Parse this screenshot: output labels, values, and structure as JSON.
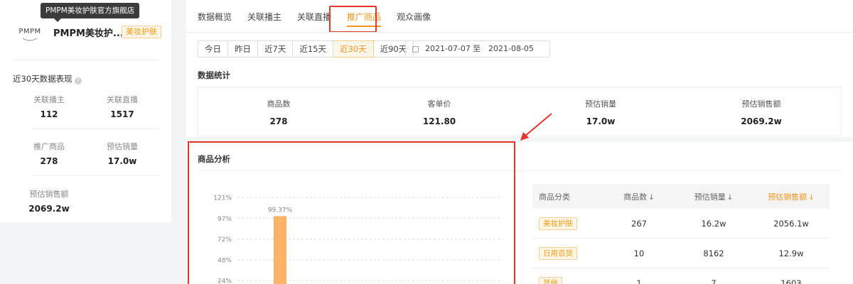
{
  "shop": {
    "logo_text": "PMPM",
    "name": "PMPM美妆护...",
    "tag": "美妆护肤",
    "tooltip": "PMPM美妆护肤官方旗舰店"
  },
  "summary": {
    "title": "近30天数据表现",
    "info_icon": "?",
    "stats": [
      {
        "label": "关联播主",
        "value": "112"
      },
      {
        "label": "关联直播",
        "value": "1517"
      },
      {
        "label": "推广商品",
        "value": "278"
      },
      {
        "label": "预估销量",
        "value": "17.0w"
      },
      {
        "label": "预估销售额",
        "value": "2069.2w"
      }
    ]
  },
  "tabs": [
    {
      "label": "数据概览"
    },
    {
      "label": "关联播主"
    },
    {
      "label": "关联直播"
    },
    {
      "label": "推广商品",
      "active": true
    },
    {
      "label": "观众画像"
    }
  ],
  "ranges": [
    {
      "label": "今日"
    },
    {
      "label": "昨日"
    },
    {
      "label": "近7天"
    },
    {
      "label": "近15天"
    },
    {
      "label": "近30天",
      "active": true
    },
    {
      "label": "近90天"
    }
  ],
  "date_range": {
    "start": "2021-07-07",
    "separator": "至",
    "end": "2021-08-05"
  },
  "data_stats": {
    "title": "数据统计",
    "items": [
      {
        "label": "商品数",
        "value": "278"
      },
      {
        "label": "客单价",
        "value": "121.80"
      },
      {
        "label": "预估销量",
        "value": "17.0w"
      },
      {
        "label": "预估销售额",
        "value": "2069.2w"
      }
    ]
  },
  "analysis": {
    "title": "商品分析",
    "table": {
      "headers": {
        "category": "商品分类",
        "count": "商品数",
        "volume": "预估销量",
        "amount": "预估销售额"
      },
      "sort_icon": "↓",
      "rows": [
        {
          "category": "美妆护肤",
          "count": "267",
          "volume": "16.2w",
          "amount": "2056.1w"
        },
        {
          "category": "日用百货",
          "count": "10",
          "volume": "8162",
          "amount": "12.9w"
        },
        {
          "category": "其他",
          "count": "1",
          "volume": "7",
          "amount": "1603"
        }
      ]
    }
  },
  "chart_data": {
    "type": "bar",
    "ytick_labels": [
      "121%",
      "97%",
      "72%",
      "48%",
      "24%"
    ],
    "ylim": [
      0,
      121
    ],
    "grid": true,
    "series": [
      {
        "values": [
          99.37
        ]
      }
    ],
    "data_labels": [
      "99.37%"
    ],
    "bar_color": "#ffb366"
  },
  "colors": {
    "accent": "#f7941d",
    "annotation_red": "#e0362c"
  }
}
